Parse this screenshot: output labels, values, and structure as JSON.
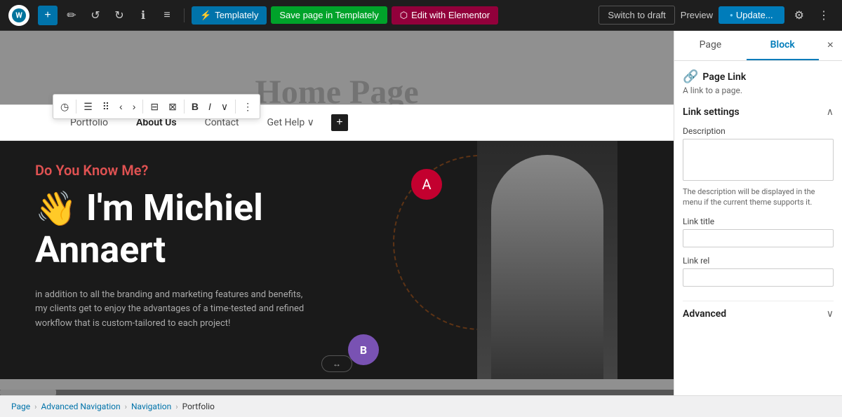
{
  "topbar": {
    "wp_logo_label": "W",
    "add_label": "+",
    "undo_label": "↺",
    "redo_label": "↻",
    "info_label": "ℹ",
    "list_label": "≡",
    "templately_label": "Templately",
    "save_templately_label": "Save page in Templately",
    "elementor_label": "Edit with Elementor",
    "switch_draft_label": "Switch to draft",
    "preview_label": "Preview",
    "update_label": "Update...",
    "gear_label": "⚙",
    "more_label": "⋮"
  },
  "editor": {
    "home_page_text": "Home Page"
  },
  "toolbar": {
    "btn1": "◷",
    "btn2": "☰",
    "btn3": "⠿",
    "btn4_prev": "‹",
    "btn5_next": "›",
    "btn6_link": "⊟",
    "btn7_unlink": "⊠",
    "btn8_bold": "B",
    "btn9_italic": "I",
    "btn10_more": "∨",
    "btn11_opts": "⋮"
  },
  "nav": {
    "items": [
      {
        "label": "Portfolio"
      },
      {
        "label": "About Us"
      },
      {
        "label": "Contact"
      },
      {
        "label": "Get Help ∨"
      }
    ],
    "add_label": "+"
  },
  "hero": {
    "eyebrow": "Do You Know Me?",
    "wave": "👋",
    "name_line1": "I'm Michiel",
    "name_line2": "Annaert",
    "description": "in addition to all the branding and marketing features and benefits, my clients get to enjoy the advantages of a time-tested and refined workflow that is custom-tailored to each project!"
  },
  "right_panel": {
    "tab_page": "Page",
    "tab_block": "Block",
    "close_label": "×",
    "page_link": {
      "title": "Page Link",
      "description": "A link to a page."
    },
    "link_settings": {
      "title": "Link settings",
      "description_label": "Description",
      "description_hint": "The description will be displayed in the menu if the current theme supports it.",
      "link_title_label": "Link title",
      "link_rel_label": "Link rel"
    },
    "advanced": {
      "label": "Advanced"
    }
  },
  "breadcrumb": {
    "items": [
      {
        "label": "Page",
        "link": true
      },
      {
        "label": "Advanced Navigation",
        "link": true
      },
      {
        "label": "Navigation",
        "link": true
      },
      {
        "label": "Portfolio",
        "link": false
      }
    ]
  }
}
